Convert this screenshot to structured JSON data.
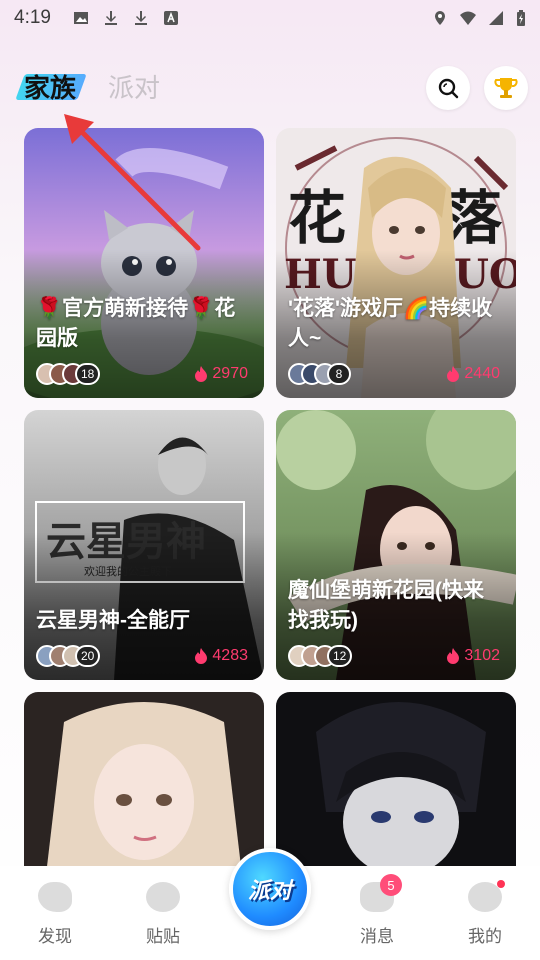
{
  "status_bar": {
    "time": "4:19"
  },
  "tabs": {
    "family": "家族",
    "party": "派对"
  },
  "rooms": [
    {
      "title": "🌹官方萌新接待🌹花园版",
      "count": "18",
      "heat": "2970"
    },
    {
      "title": "'花落'游戏厅🌈持续收人~",
      "count": "8",
      "heat": "2440"
    },
    {
      "title": "云星男神-全能厅",
      "count": "20",
      "heat": "4283"
    },
    {
      "title": "魔仙堡萌新花园(快来找我玩)",
      "count": "12",
      "heat": "3102"
    }
  ],
  "bottom_nav": {
    "discover": "发现",
    "posts": "贴贴",
    "center": "派对",
    "messages": "消息",
    "messages_badge": "5",
    "me": "我的"
  },
  "colors": {
    "accent": "#ff3b6f",
    "tab_highlight": "#22d1ee",
    "center_button": "#1f8bff"
  }
}
